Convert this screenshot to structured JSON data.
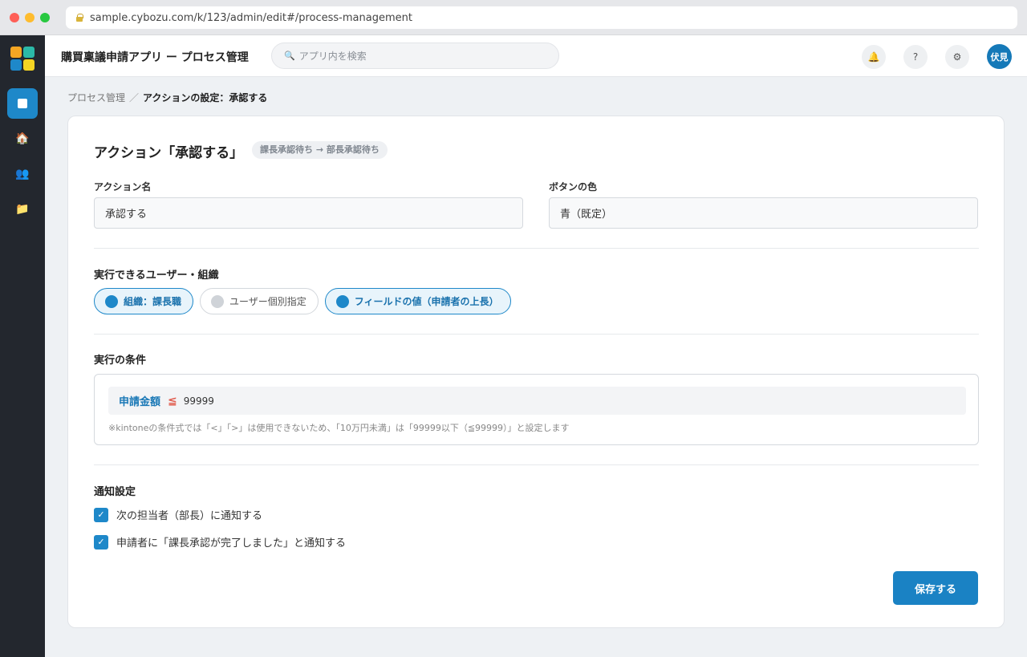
{
  "browser": {
    "url": "sample.cybozu.com/k/123/admin/edit#/process-management"
  },
  "colors": {
    "accent": "#1e88c9",
    "sidebar_bg": "#23272e",
    "operator": "#e05a4c",
    "logo": [
      "#f5a623",
      "#2bb9a8",
      "#1e88c9",
      "#f5d523"
    ]
  },
  "sidebar": {
    "items": [
      {
        "name": "app-icon",
        "glyph": "■"
      },
      {
        "name": "home-icon",
        "glyph": "🏠"
      },
      {
        "name": "users-icon",
        "glyph": "👥"
      },
      {
        "name": "folder-icon",
        "glyph": "📁"
      }
    ]
  },
  "header": {
    "title": "購買稟議申請アプリ ー プロセス管理",
    "search_placeholder": "アプリ内を検索",
    "icons": {
      "bell": "🔔",
      "help": "?",
      "settings": "⚙"
    },
    "avatar": "伏見"
  },
  "breadcrumb": {
    "parent": "プロセス管理",
    "separator": "／",
    "current": "アクションの設定：承認する"
  },
  "card": {
    "title": "アクション「承認する」",
    "transition": "課長承認待ち → 部長承認待ち",
    "action_name": {
      "label": "アクション名",
      "value": "承認する"
    },
    "button_color": {
      "label": "ボタンの色",
      "value": "青（既定）"
    },
    "executors": {
      "title": "実行できるユーザー・組織",
      "chips": [
        {
          "label": "組織：課長職",
          "selected": true
        },
        {
          "label": "ユーザー個別指定",
          "selected": false
        },
        {
          "label": "フィールドの値（申請者の上長）",
          "selected": true
        }
      ]
    },
    "condition": {
      "title": "実行の条件",
      "field": "申請金額",
      "operator": "≦",
      "value": "99999",
      "note": "※kintoneの条件式では「<」「>」は使用できないため、「10万円未満」は「99999以下（≦99999）」と設定します"
    },
    "notifications": {
      "title": "通知設定",
      "items": [
        {
          "label": "次の担当者（部長）に通知する",
          "checked": true
        },
        {
          "label": "申請者に「課長承認が完了しました」と通知する",
          "checked": true
        }
      ]
    },
    "save_label": "保存する"
  }
}
